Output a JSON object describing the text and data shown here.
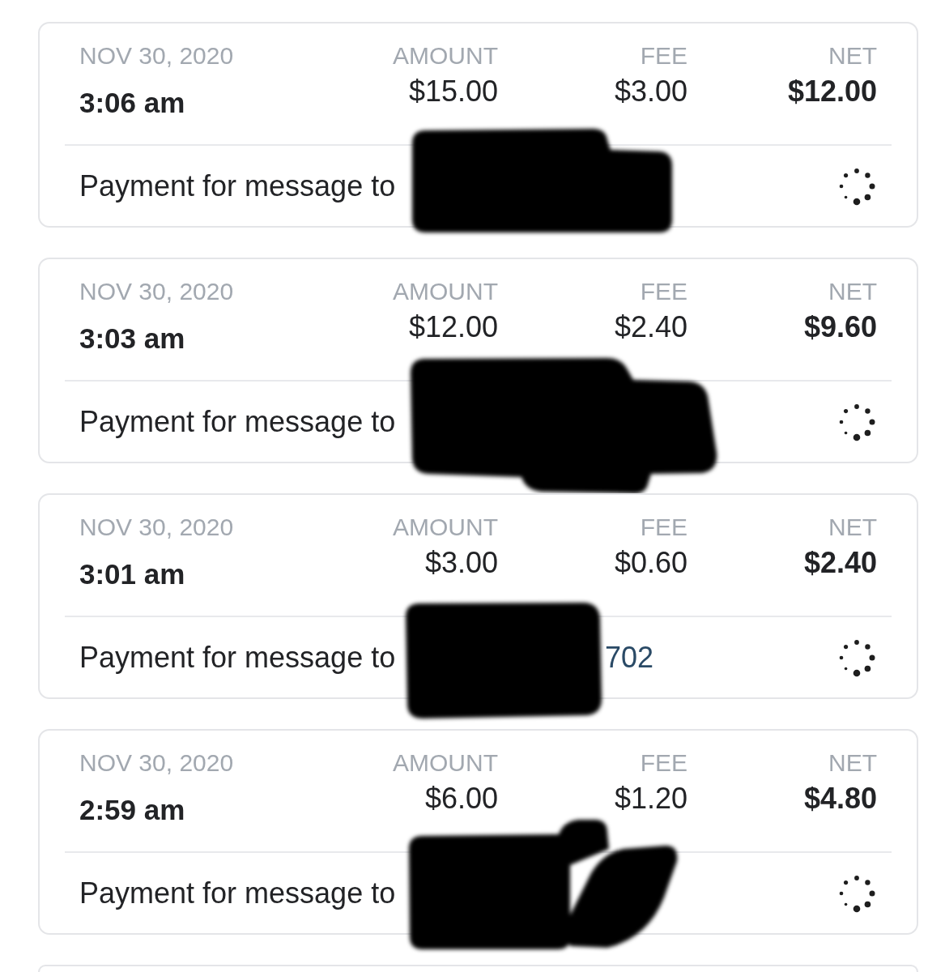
{
  "transactions": [
    {
      "date": "NOV 30, 2020",
      "time": "3:06 am",
      "amount_label": "AMOUNT",
      "amount": "$15.00",
      "fee_label": "FEE",
      "fee": "$3.00",
      "net_label": "NET",
      "net": "$12.00",
      "description": "Payment for message to",
      "redacted": true,
      "pending": true
    },
    {
      "date": "NOV 30, 2020",
      "time": "3:03 am",
      "amount_label": "AMOUNT",
      "amount": "$12.00",
      "fee_label": "FEE",
      "fee": "$2.40",
      "net_label": "NET",
      "net": "$9.60",
      "description": "Payment for message to",
      "redacted": true,
      "pending": true
    },
    {
      "date": "NOV 30, 2020",
      "time": "3:01 am",
      "amount_label": "AMOUNT",
      "amount": "$3.00",
      "fee_label": "FEE",
      "fee": "$0.60",
      "net_label": "NET",
      "net": "$2.40",
      "description": "Payment for message to",
      "recipient_fragment": "702",
      "redacted": true,
      "pending": true
    },
    {
      "date": "NOV 30, 2020",
      "time": "2:59 am",
      "amount_label": "AMOUNT",
      "amount": "$6.00",
      "fee_label": "FEE",
      "fee": "$1.20",
      "net_label": "NET",
      "net": "$4.80",
      "description": "Payment for message to",
      "redacted": true,
      "pending": true
    }
  ]
}
